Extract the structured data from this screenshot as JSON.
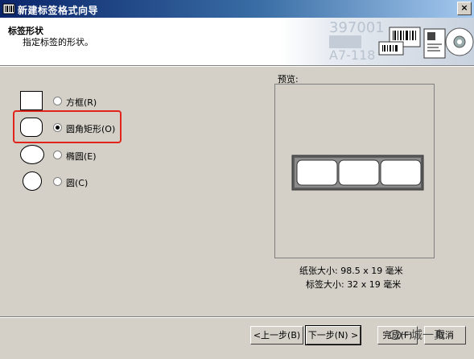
{
  "window": {
    "title": "新建标签格式向导",
    "close_glyph": "×"
  },
  "header": {
    "title": "标签形状",
    "subtitle": "指定标签的形状。",
    "art_text_1": "397001",
    "art_text_2": "A7-118"
  },
  "options": [
    {
      "label": "方框(R)",
      "shape": "rectangle",
      "selected": false
    },
    {
      "label": "圆角矩形(O)",
      "shape": "rounded-rectangle",
      "selected": true
    },
    {
      "label": "椭圆(E)",
      "shape": "ellipse",
      "selected": false
    },
    {
      "label": "圆(C)",
      "shape": "circle",
      "selected": false
    }
  ],
  "preview": {
    "label": "预览:",
    "labels_across": 3,
    "paper_size": "纸张大小: 98.5 x 19 毫米",
    "label_size": "标签大小: 32 x 19 毫米"
  },
  "buttons": {
    "prev": "<上一步(B)",
    "next": "下一步(N) >",
    "finish": "完成(F)",
    "cancel": "取消"
  },
  "watermark": "一城一真",
  "colors": {
    "highlight": "#e0241b",
    "titlebar_start": "#0a246a",
    "dialog_bg": "#d4d0c8"
  }
}
